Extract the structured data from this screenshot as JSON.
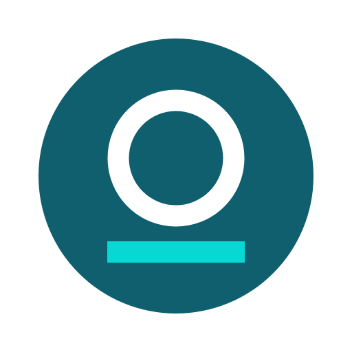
{
  "icon": {
    "name": "app-logo-icon",
    "colors": {
      "background": "#ffffff",
      "disc": "#0f5f6e",
      "ring": "#ffffff",
      "bar": "#08d8d4"
    }
  }
}
